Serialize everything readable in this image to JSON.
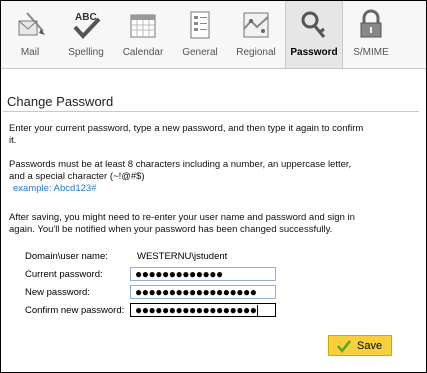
{
  "toolbar": {
    "items": [
      {
        "label": "Mail",
        "icon": "mail-icon"
      },
      {
        "label": "Spelling",
        "icon": "spelling-icon",
        "icon_text": "ABC"
      },
      {
        "label": "Calendar",
        "icon": "calendar-icon"
      },
      {
        "label": "General",
        "icon": "general-icon"
      },
      {
        "label": "Regional",
        "icon": "regional-icon"
      },
      {
        "label": "Password",
        "icon": "password-key-icon",
        "active": true
      },
      {
        "label": "S/MIME",
        "icon": "smime-lock-icon"
      }
    ]
  },
  "section": {
    "title": "Change Password"
  },
  "instructions": {
    "para1_line1": "Enter your current password, type a new password, and then type it again to confirm",
    "para1_line2": "it.",
    "para2_line1": "Passwords must be at least 8 characters including a number, an uppercase letter,",
    "para2_line2": "and a special character (~!@#$)",
    "example": "example: Abcd123#",
    "para3_line1": "After saving, you might need to re-enter your user name and password and sign in",
    "para3_line2": "again. You'll be notified when your password has been changed successfully."
  },
  "form": {
    "domain_label": "Domain\\user name:",
    "domain_value": "WESTERNU\\jstudent",
    "current_label": "Current password:",
    "current_value": "●●●●●●●●●●●●●",
    "new_label": "New password:",
    "new_value": "●●●●●●●●●●●●●●●●●●",
    "confirm_label": "Confirm new password:",
    "confirm_value": "●●●●●●●●●●●●●●●●●●"
  },
  "actions": {
    "save_label": "Save"
  },
  "colors": {
    "save_button": "#f8cf3c",
    "link": "#1f7bd3",
    "checkmark": "#5aa62b"
  }
}
